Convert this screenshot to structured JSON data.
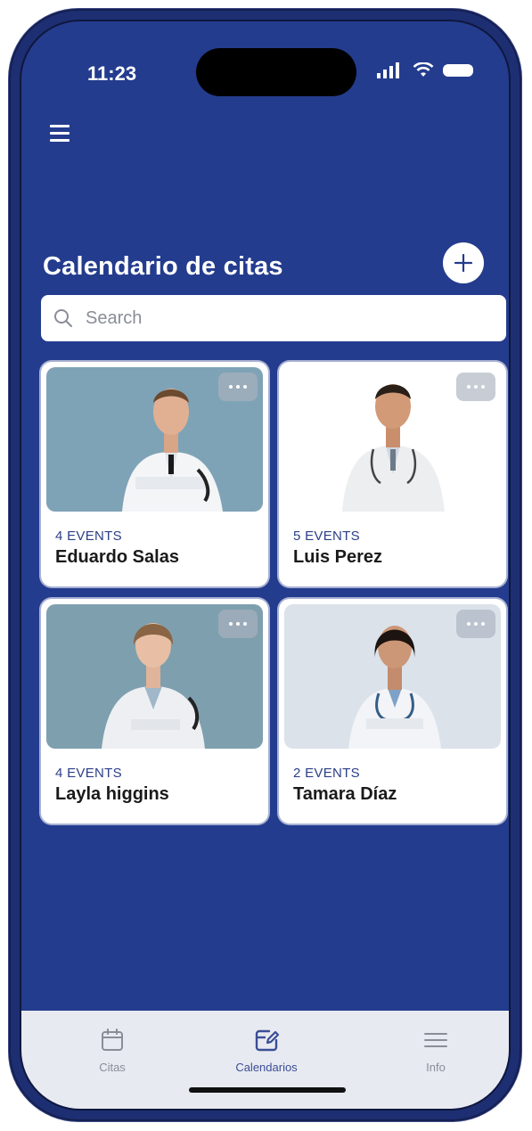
{
  "status_bar": {
    "time": "11:23"
  },
  "header": {
    "title": "Calendario de citas"
  },
  "search": {
    "placeholder": "Search"
  },
  "doctors": [
    {
      "events": "4 EVENTS",
      "name": "Eduardo Salas"
    },
    {
      "events": "5 EVENTS",
      "name": "Luis Perez"
    },
    {
      "events": "4 EVENTS",
      "name": "Layla higgins"
    },
    {
      "events": "2 EVENTS",
      "name": "Tamara Díaz"
    }
  ],
  "tabs": [
    {
      "label": "Citas",
      "icon": "calendar-icon"
    },
    {
      "label": "Calendarios",
      "icon": "edit-calendar-icon"
    },
    {
      "label": "Info",
      "icon": "menu-lines-icon"
    }
  ],
  "colors": {
    "background": "#243c8e",
    "card": "#ffffff",
    "events_text": "#2c3f88",
    "tab_bar": "#e8eaf1",
    "tab_active": "#3a4e95"
  }
}
